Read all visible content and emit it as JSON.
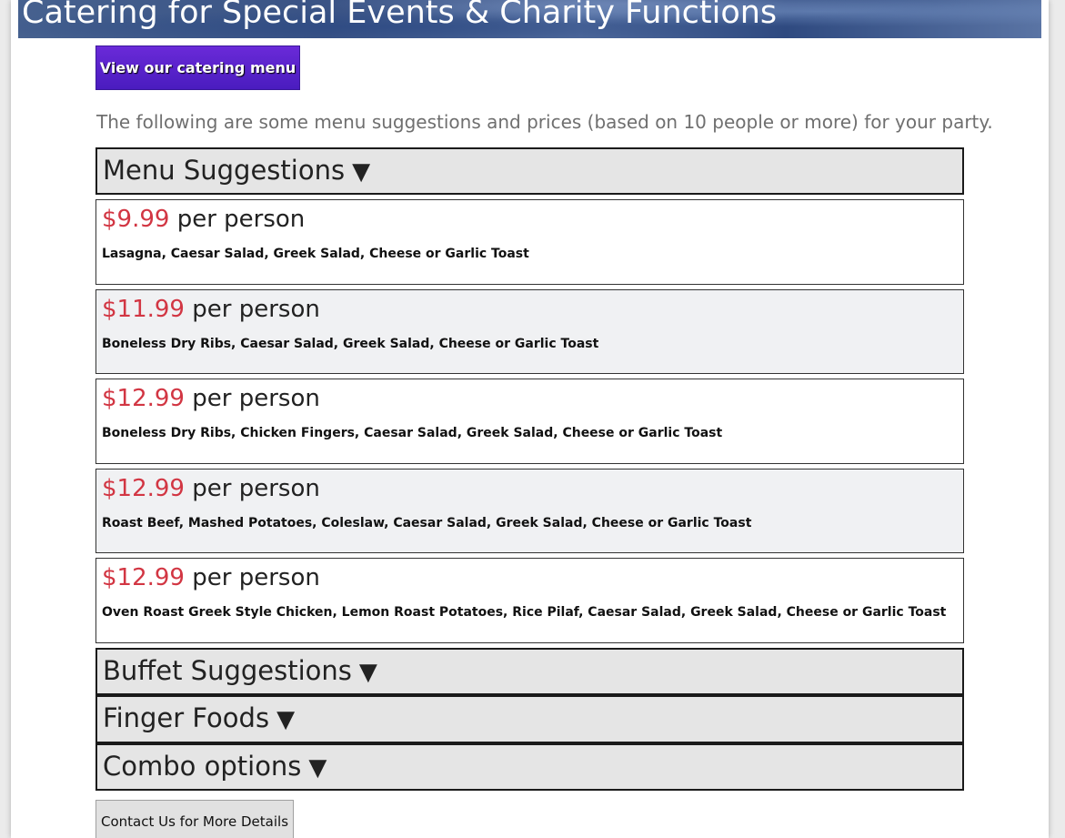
{
  "hero": {
    "title": "Catering for Special Events & Charity Functions"
  },
  "catering_menu_button": "View our catering menu",
  "intro_text": "The following are some menu suggestions and prices (based on 10 people or more) for your party.",
  "sections": {
    "menu_suggestions": {
      "label": "Menu Suggestions",
      "arrow": "▼"
    },
    "buffet_suggestions": {
      "label": "Buffet Suggestions",
      "arrow": "▼"
    },
    "finger_foods": {
      "label": "Finger Foods",
      "arrow": "▼"
    },
    "combo_options": {
      "label": "Combo options",
      "arrow": "▼"
    }
  },
  "menu_items": [
    {
      "price": "$9.99",
      "unit": " per person",
      "items": "Lasagna, Caesar Salad, Greek Salad, Cheese or Garlic Toast"
    },
    {
      "price": "$11.99",
      "unit": " per person",
      "items": "Boneless Dry Ribs, Caesar Salad, Greek Salad, Cheese or Garlic Toast"
    },
    {
      "price": "$12.99",
      "unit": " per person",
      "items": "Boneless Dry Ribs, Chicken Fingers, Caesar Salad, Greek Salad, Cheese or Garlic Toast"
    },
    {
      "price": "$12.99",
      "unit": " per person",
      "items": "Roast Beef, Mashed Potatoes, Coleslaw, Caesar Salad, Greek Salad, Cheese or Garlic Toast"
    },
    {
      "price": "$12.99",
      "unit": " per person",
      "items": "Oven Roast Greek Style Chicken, Lemon Roast Potatoes, Rice Pilaf, Caesar Salad, Greek Salad, Cheese or Garlic Toast"
    }
  ],
  "contact_button": "Contact Us for More Details",
  "colors": {
    "price": "#d23643",
    "button_purple": "#5a22cc",
    "header_bg": "#e5e5e5"
  }
}
